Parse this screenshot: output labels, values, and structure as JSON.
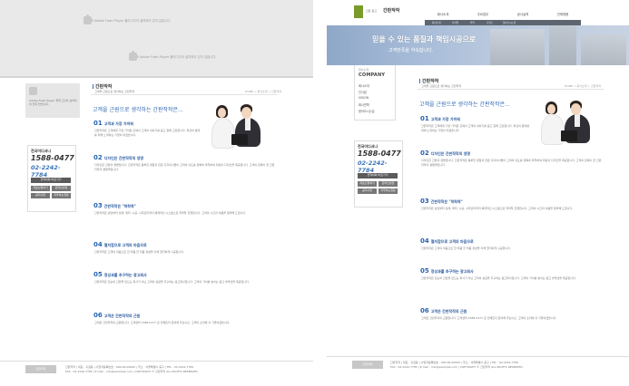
{
  "flash_notice": "Adobe Flash Player 플러그인이 설치되어 있지 않습니다.",
  "flash_notice_sidebar": "Adobe Flash Player 플러그인이 설치되어 있지 않습니다.",
  "company_name": "간판작작",
  "company_name_en": "COMPANY",
  "logo_small": "간판 광고",
  "gnb": [
    {
      "label": "회사소개"
    },
    {
      "label": "주요업무"
    },
    {
      "label": "공사실적"
    },
    {
      "label": "인재채용"
    }
  ],
  "gnb_sub": [
    "회사소개",
    "인사말",
    "연혁",
    "조직도",
    "찾아오시는길"
  ],
  "hero": {
    "line1": "믿을 수 있는 품질과 책임시공으로",
    "line2": "고객만족을 약속합니다."
  },
  "lnb": {
    "small_title": "회사소개",
    "big_title": "COMPANY",
    "items": [
      "회사소개",
      "인사말",
      "VISION",
      "회사연혁",
      "찾아오시는길"
    ]
  },
  "contact": {
    "title": "전국어디서나",
    "phone1": "1588-0477",
    "phone2": "02-2242-7784",
    "btn_main": "견적의뢰 바로가기",
    "btns": [
      "자료신청하기",
      "온라인상담",
      "공지사항",
      "자주하는질문"
    ]
  },
  "page": {
    "title": "간판작작",
    "subtitle": "고객을 근원으로 생각하는 간판작작",
    "breadcrumb": "HOME > 회사소개 > 간판작작",
    "slogan": "고객을 근원으로 생각하는 간판작작은..."
  },
  "sections": [
    {
      "num": "01",
      "title": "고객과 가장 가까워",
      "text": "간판작작은 고객에게 가장 가까운 곳에서 고객의 이야기를 듣고 함께 고민합니다. 최선의 결과를 위해 노력하는 기업이 되겠습니다."
    },
    {
      "num": "02",
      "title": "디자인은 간판작작의 생명",
      "text": "디자인은 간판의 생명입니다. 간판작작은 풍부한 경험과 전문 디자이너들이 고객의 의도를 정확히 파악하여 최상의 디자인을 제공합니다. 고객의 만족이 곧 간판작작의 경쟁력입니다."
    },
    {
      "num": "03",
      "title": "간판작작은 \"착착착\"",
      "text": "간판작작은 상담부터 설계, 제작, 시공, 사후관리까지 체계적인 시스템으로 착착착 진행합니다. 고객의 시간과 비용을 절약해 드립니다."
    },
    {
      "num": "04",
      "title": "철저함으로 고객의 마음으로",
      "text": "간판작작은 고객의 마음으로 한 작품 한 작품 정성을 다해 철저하게 시공합니다."
    },
    {
      "num": "05",
      "title": "정성과를 추구하는 광고회사",
      "text": "간판작작은 단순히 간판을 만드는 회사가 아닌 고객의 성공을 추구하는 광고회사입니다. 고객의 가치를 높이는 광고 솔루션을 제공합니다."
    },
    {
      "num": "06",
      "title": "고객은 간판작작의 근원",
      "text": "고객은 간판작작의 근원입니다. 고객센터 1588-0477 로 언제든지 문의해 주십시오. 고객의 소리에 귀 기울이겠습니다."
    }
  ],
  "footer": {
    "logo": "간판작작",
    "line1": "간판작작 | 대표 : 홍길동 | 사업자등록번호 : 000-00-00000 | 주소 : 서울특별시 중구 | TEL : 02-2242-7784",
    "line2": "FAX : 02-2242-7785 | E-mail : info@example.com | COPYRIGHT © 간판작작 ALL RIGHTS RESERVED."
  }
}
